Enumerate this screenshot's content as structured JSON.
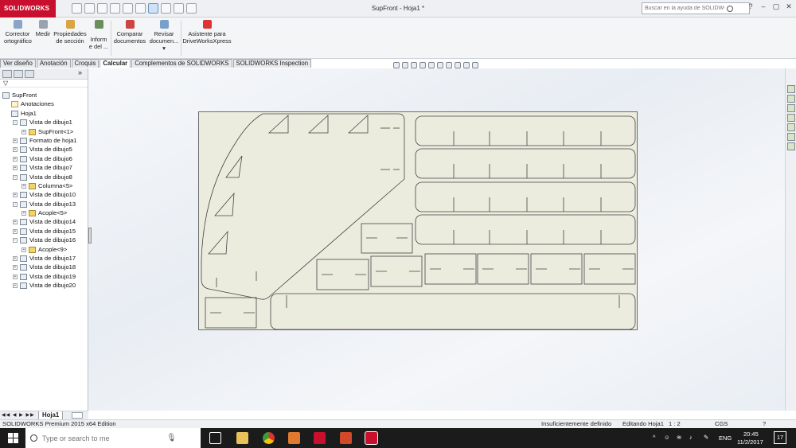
{
  "app": {
    "logo": "SOLIDWORKS",
    "title": "SupFront - Hoja1 *"
  },
  "search": {
    "placeholder": "Buscar en la ayuda de SOLIDWORKS"
  },
  "window_controls": [
    "?",
    "–",
    "▢",
    "✕"
  ],
  "ribbon": {
    "buttons": [
      {
        "id": "spell",
        "label1": "Corrector",
        "label2": "ortográfico"
      },
      {
        "id": "measure",
        "label1": "Medir",
        "label2": ""
      },
      {
        "id": "props",
        "label1": "Propiedades",
        "label2": "de sección"
      },
      {
        "id": "report",
        "label1": "Inform",
        "label2": "e del ..."
      },
      {
        "id": "compare",
        "label1": "Comparar",
        "label2": "documentos"
      },
      {
        "id": "review",
        "label1": "Revisar",
        "label2": "documen..."
      },
      {
        "id": "driveworks",
        "label1": "Asistente para",
        "label2": "DriveWorksXpress"
      }
    ]
  },
  "tabs": [
    "Ver diseño",
    "Anotación",
    "Croquis",
    "Calcular",
    "Complementos de SOLIDWORKS",
    "SOLIDWORKS Inspection"
  ],
  "active_tab": "Calcular",
  "tree": [
    {
      "label": "SupFront",
      "level": 0,
      "icon": "drawing-icon"
    },
    {
      "label": "Anotaciones",
      "level": 1,
      "icon": "annotations-icon"
    },
    {
      "label": "Hoja1",
      "level": 1,
      "icon": "sheet-icon",
      "expanded": true
    },
    {
      "label": "Vista de dibujo1",
      "level": 2,
      "icon": "view-icon",
      "expanded": true
    },
    {
      "label": "SupFront<1>",
      "level": 3,
      "icon": "part-icon"
    },
    {
      "label": "Formato de hoja1",
      "level": 2,
      "icon": "sheet-format-icon"
    },
    {
      "label": "Vista de dibujo5",
      "level": 2,
      "icon": "view-icon"
    },
    {
      "label": "Vista de dibujo6",
      "level": 2,
      "icon": "view-icon"
    },
    {
      "label": "Vista de dibujo7",
      "level": 2,
      "icon": "view-icon"
    },
    {
      "label": "Vista de dibujo8",
      "level": 2,
      "icon": "view-icon",
      "expanded": true
    },
    {
      "label": "Columna<5>",
      "level": 3,
      "icon": "part-icon"
    },
    {
      "label": "Vista de dibujo10",
      "level": 2,
      "icon": "view-icon"
    },
    {
      "label": "Vista de dibujo13",
      "level": 2,
      "icon": "view-icon",
      "expanded": true
    },
    {
      "label": "Acople<5>",
      "level": 3,
      "icon": "part-icon"
    },
    {
      "label": "Vista de dibujo14",
      "level": 2,
      "icon": "view-icon"
    },
    {
      "label": "Vista de dibujo15",
      "level": 2,
      "icon": "view-icon"
    },
    {
      "label": "Vista de dibujo16",
      "level": 2,
      "icon": "view-icon",
      "expanded": true
    },
    {
      "label": "Acople<9>",
      "level": 3,
      "icon": "part-icon"
    },
    {
      "label": "Vista de dibujo17",
      "level": 2,
      "icon": "view-icon"
    },
    {
      "label": "Vista de dibujo18",
      "level": 2,
      "icon": "view-icon"
    },
    {
      "label": "Vista de dibujo19",
      "level": 2,
      "icon": "view-icon"
    },
    {
      "label": "Vista de dibujo20",
      "level": 2,
      "icon": "view-icon"
    }
  ],
  "sheet_tab": "Hoja1",
  "status": {
    "edition": "SOLIDWORKS Premium 2015 x64 Edition",
    "definition": "Insuficientemente definido",
    "editing": "Editando Hoja1",
    "scale": "1 : 2",
    "units": "CGS"
  },
  "taskbar": {
    "search_placeholder": "Type or search to me",
    "lang": "ENG",
    "time": "20:45",
    "date": "11/2/2017",
    "notifications": "17"
  },
  "colors": {
    "logo_red": "#c8102e",
    "sheet_fill": "#ebebde",
    "taskbar": "#1b1b1b"
  }
}
